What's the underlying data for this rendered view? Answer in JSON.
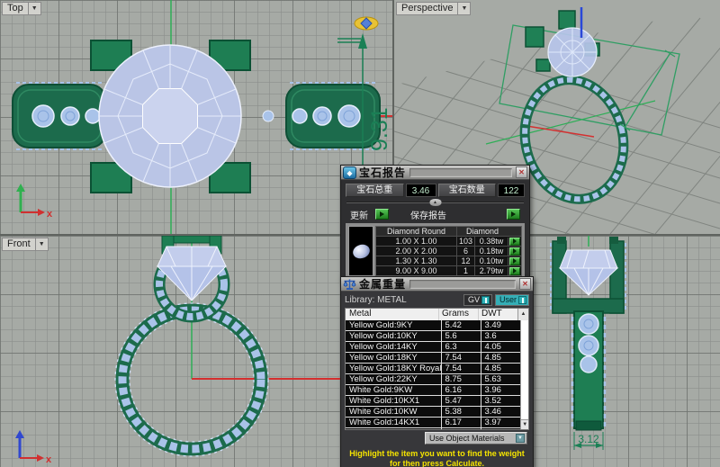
{
  "viewports": {
    "top": {
      "label": "Top"
    },
    "perspective": {
      "label": "Perspective"
    },
    "front": {
      "label": "Front"
    }
  },
  "icons": {
    "dropdown": "▼",
    "close": "✕",
    "scroll_up": "▲",
    "scroll_down": "▼",
    "collapse": "▲",
    "gem": "◆"
  },
  "axis": {
    "x_label": "x"
  },
  "dimensions": {
    "ring_height_top_view": "9.31",
    "band_width_right_view": "3.12"
  },
  "gem_report": {
    "title": "宝石报告",
    "total_weight_label": "宝石总重",
    "total_weight_value": "3.46",
    "count_label": "宝石数量",
    "count_value": "122",
    "update_label": "更新",
    "save_label": "保存报告",
    "table": {
      "col1_header": "Diamond Round",
      "col2_header": "Diamond",
      "rows": [
        {
          "size": "1.00 X 1.00",
          "count": "103",
          "weight": "0.38tw"
        },
        {
          "size": "2.00 X 2.00",
          "count": "6",
          "weight": "0.18tw"
        },
        {
          "size": "1.30 X 1.30",
          "count": "12",
          "weight": "0.10tw"
        },
        {
          "size": "9.00 X 9.00",
          "count": "1",
          "weight": "2.79tw"
        }
      ]
    }
  },
  "metal_weight": {
    "title": "金属重量",
    "library_label": "Library: METAL",
    "gv_label": "GV",
    "user_label": "User",
    "columns": {
      "metal": "Metal",
      "grams": "Grams",
      "dwt": "DWT"
    },
    "rows": [
      [
        "Yellow Gold:9KY",
        "5.42",
        "3.49"
      ],
      [
        "Yellow Gold:10KY",
        "5.6",
        "3.6"
      ],
      [
        "Yellow Gold:14KY",
        "6.3",
        "4.05"
      ],
      [
        "Yellow Gold:18KY",
        "7.54",
        "4.85"
      ],
      [
        "Yellow Gold:18KY Royal",
        "7.54",
        "4.85"
      ],
      [
        "Yellow Gold:22KY",
        "8.75",
        "5.63"
      ],
      [
        "White Gold:9KW",
        "6.16",
        "3.96"
      ],
      [
        "White Gold:10KX1",
        "5.47",
        "3.52"
      ],
      [
        "White Gold:10KW",
        "5.38",
        "3.46"
      ],
      [
        "White Gold:14KX1",
        "6.17",
        "3.97"
      ]
    ],
    "dropdown_value": "Use Object Materials",
    "hint": "Highlight the item you want to find the weight for then press Calculate."
  },
  "colors": {
    "viewport_bg": "#a6aaa5",
    "ring_green": "#1c6b4c",
    "stone_blue": "#a9c3e9",
    "diamond_fill": "#bac5e6",
    "dimension_green": "#1a7f55",
    "axis_red": "#d43030",
    "axis_green": "#2fae57",
    "axis_blue": "#2a48d8",
    "button_green": "#2f9e2f",
    "teal_accent": "#2fb3b9",
    "hint_yellow": "#f5e400"
  }
}
